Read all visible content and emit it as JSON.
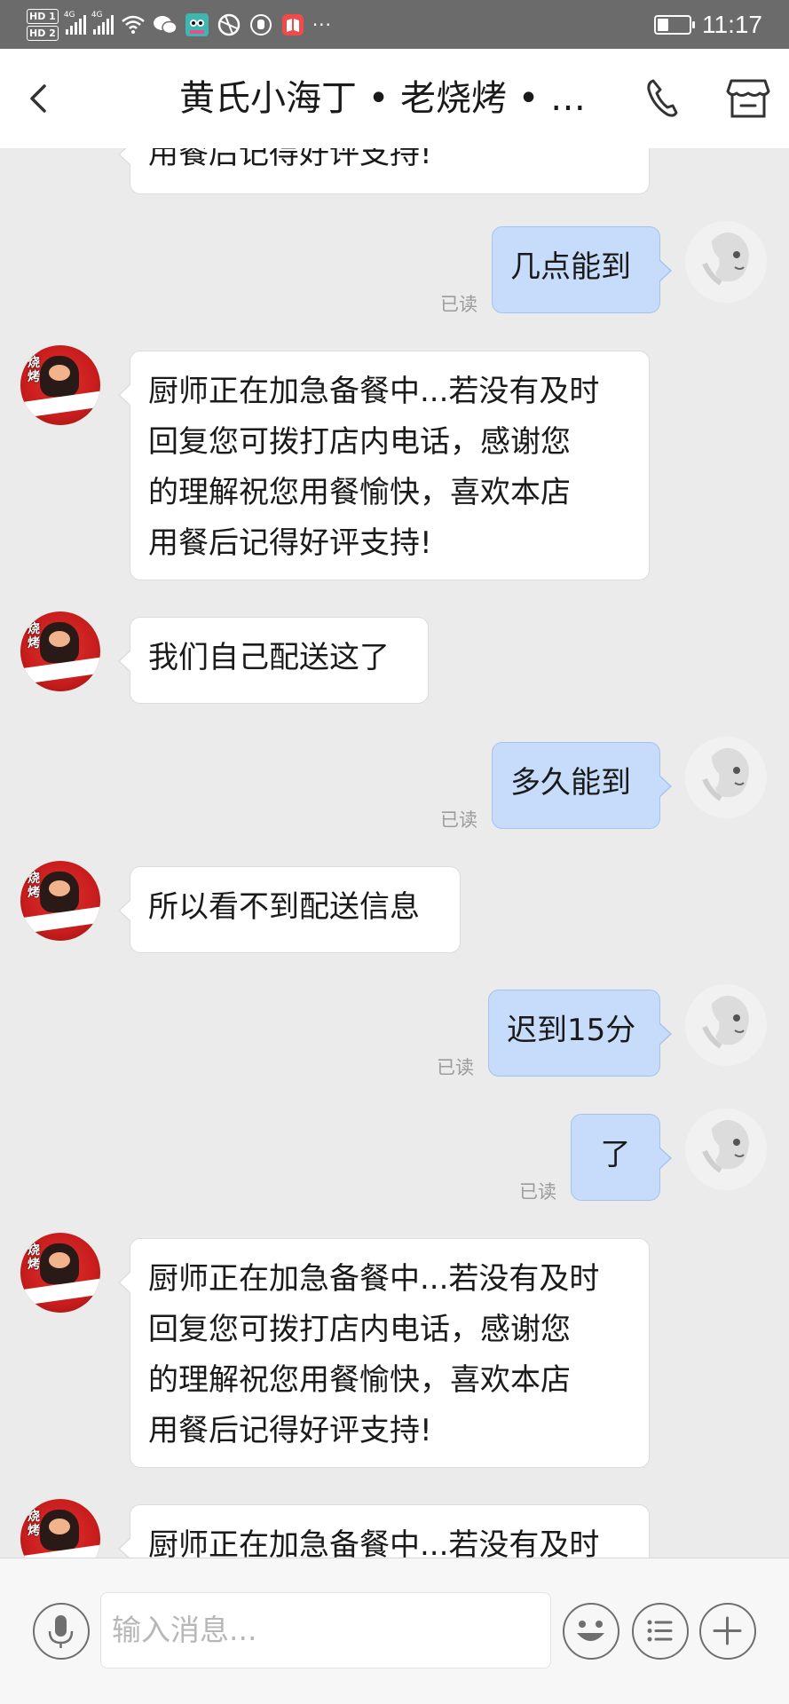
{
  "status_bar": {
    "hd1": "HD 1",
    "hd2": "HD 2",
    "signal1": "4G",
    "signal2": "4G",
    "more": "···",
    "battery_level": 0.35,
    "time": "11:17"
  },
  "header": {
    "title": "黄氏小海丁 • 老烧烤 • …",
    "icons": [
      "back-arrow-icon",
      "phone-icon",
      "shop-icon"
    ]
  },
  "messages": [
    {
      "from": "shop",
      "text": "用餐后记得好评支持!"
    },
    {
      "from": "user",
      "text": "几点能到",
      "status": "已读"
    },
    {
      "from": "shop",
      "lines": [
        "厨师正在加急备餐中...若没有及时",
        "回复您可拨打店内电话，感谢您",
        "的理解祝您用餐愉快，喜欢本店",
        "用餐后记得好评支持!"
      ]
    },
    {
      "from": "shop",
      "text": "我们自己配送这了"
    },
    {
      "from": "user",
      "text": "多久能到",
      "status": "已读"
    },
    {
      "from": "shop",
      "text": "所以看不到配送信息"
    },
    {
      "from": "user",
      "text": "迟到15分",
      "status": "已读"
    },
    {
      "from": "user",
      "text": "了",
      "status": "已读"
    },
    {
      "from": "shop",
      "lines": [
        "厨师正在加急备餐中...若没有及时",
        "回复您可拨打店内电话，感谢您",
        "的理解祝您用餐愉快，喜欢本店",
        "用餐后记得好评支持!"
      ]
    },
    {
      "from": "shop",
      "text": "厨师正在加急备餐中...若没有及时"
    }
  ],
  "shop_avatar_text": "烧烤",
  "input_bar": {
    "placeholder": "输入消息...",
    "icons": [
      "microphone-icon",
      "emoji-icon",
      "list-icon",
      "plus-icon"
    ]
  },
  "colors": {
    "status_bar_bg": "#6b6b6b",
    "chat_bg": "#ebebeb",
    "outgoing_bubble": "#c6dcfa",
    "incoming_bubble": "#ffffff",
    "shop_avatar_red": "#c81d1d"
  }
}
